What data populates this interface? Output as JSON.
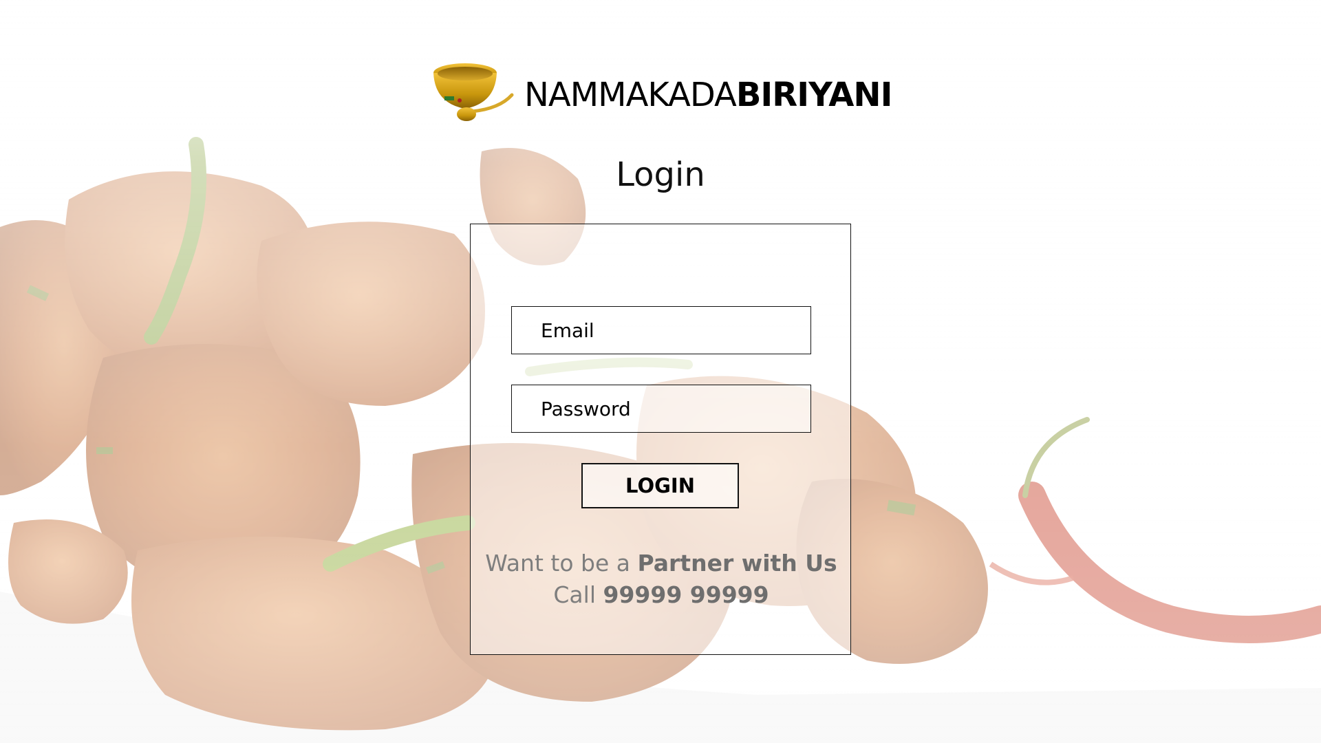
{
  "brand": {
    "name_light": "NAMMAKADA",
    "name_bold": "BIRIYANI",
    "logo_icon": "biryani-bowl-spoon-icon"
  },
  "page_title": "Login",
  "form": {
    "email_placeholder": "Email",
    "password_placeholder": "Password",
    "login_label": "LOGIN"
  },
  "partner": {
    "line1_prefix": "Want to be a ",
    "line1_link": "Partner with Us",
    "line2_prefix": "Call ",
    "line2_phone": "99999 99999"
  },
  "colors": {
    "text": "#000000",
    "muted_text": "#7e7e7e",
    "border": "#111111",
    "logo_gold": "#c8960c"
  }
}
